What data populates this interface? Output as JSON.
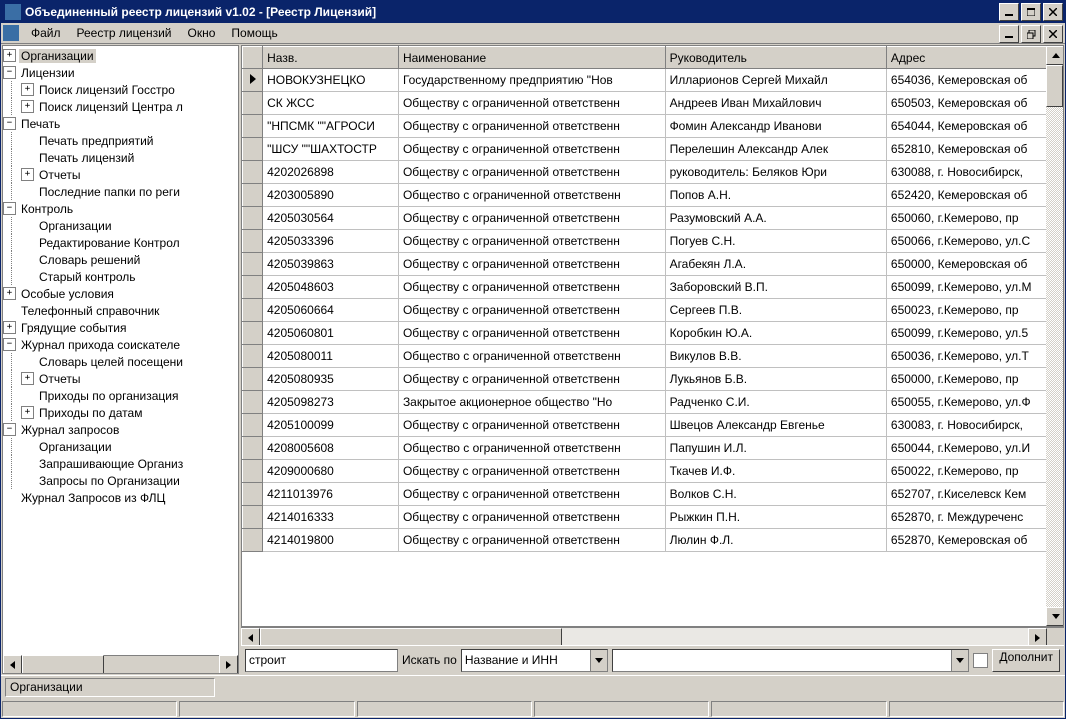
{
  "window": {
    "title": "Объединенный реестр лицензий v1.02 - [Реестр Лицензий]"
  },
  "menu": {
    "items": [
      "Файл",
      "Реестр лицензий",
      "Окно",
      "Помощь"
    ]
  },
  "tree": [
    {
      "level": 0,
      "pm": "+",
      "label": "Организации",
      "selected": true
    },
    {
      "level": 0,
      "pm": "-",
      "label": "Лицензии"
    },
    {
      "level": 1,
      "pm": "+",
      "label": "Поиск лицензий Госстро"
    },
    {
      "level": 1,
      "pm": "+",
      "label": "Поиск лицензий Центра л"
    },
    {
      "level": 0,
      "pm": "-",
      "label": "Печать"
    },
    {
      "level": 1,
      "pm": "",
      "label": "Печать предприятий"
    },
    {
      "level": 1,
      "pm": "",
      "label": "Печать лицензий"
    },
    {
      "level": 1,
      "pm": "+",
      "label": "Отчеты"
    },
    {
      "level": 1,
      "pm": "",
      "label": "Последние папки по реги"
    },
    {
      "level": 0,
      "pm": "-",
      "label": "Контроль"
    },
    {
      "level": 1,
      "pm": "",
      "label": "Организации"
    },
    {
      "level": 1,
      "pm": "",
      "label": "Редактирование Контрол"
    },
    {
      "level": 1,
      "pm": "",
      "label": "Словарь решений"
    },
    {
      "level": 1,
      "pm": "",
      "label": "Старый контроль"
    },
    {
      "level": 0,
      "pm": "+",
      "label": "Особые условия"
    },
    {
      "level": 0,
      "pm": "",
      "label": "Телефонный справочник"
    },
    {
      "level": 0,
      "pm": "+",
      "label": "Грядущие события"
    },
    {
      "level": 0,
      "pm": "-",
      "label": "Журнал прихода соискателе"
    },
    {
      "level": 1,
      "pm": "",
      "label": "Словарь целей посещени"
    },
    {
      "level": 1,
      "pm": "+",
      "label": "Отчеты"
    },
    {
      "level": 1,
      "pm": "",
      "label": "Приходы по организация"
    },
    {
      "level": 1,
      "pm": "+",
      "label": "Приходы по датам"
    },
    {
      "level": 0,
      "pm": "-",
      "label": "Журнал запросов"
    },
    {
      "level": 1,
      "pm": "",
      "label": "Организации"
    },
    {
      "level": 1,
      "pm": "",
      "label": "Запрашивающие Организ"
    },
    {
      "level": 1,
      "pm": "",
      "label": "Запросы по Организации"
    },
    {
      "level": 0,
      "pm": "",
      "label": "Журнал Запросов из ФЛЦ"
    }
  ],
  "grid": {
    "columns": [
      "Назв.",
      "Наименование",
      "Руководитель",
      "Адрес"
    ],
    "rows": [
      {
        "marker": "▶",
        "c": [
          " НОВОКУЗНЕЦКО",
          "Государственному предприятию \"Нов",
          "Илларионов Сергей Михайл",
          "654036, Кемеровская об"
        ]
      },
      {
        "marker": "",
        "c": [
          " СК ЖСС",
          "Обществу с ограниченной ответственн",
          "Андреев Иван Михайлович",
          "650503, Кемеровская об"
        ]
      },
      {
        "marker": "",
        "c": [
          "\"НПСМК \"\"АГРОСИ",
          "Обществу с ограниченной ответственн",
          "Фомин Александр Иванови",
          "654044, Кемеровская об"
        ]
      },
      {
        "marker": "",
        "c": [
          "\"ШСУ \"\"ШАХТОСТР",
          "Обществу с ограниченной ответственн",
          "Перелешин Александр Алек",
          "652810, Кемеровская об"
        ]
      },
      {
        "marker": "",
        "c": [
          "4202026898",
          "Обществу с ограниченной ответственн",
          "руководитель: Беляков Юри",
          "630088, г. Новосибирск,"
        ]
      },
      {
        "marker": "",
        "c": [
          "4203005890",
          "Общество с ограниченной ответственн",
          "Попов А.Н.",
          "652420, Кемеровская об"
        ]
      },
      {
        "marker": "",
        "c": [
          "4205030564",
          "Обществу с ограниченной ответственн",
          "Разумовский А.А.",
          " 650060, г.Кемерово, пр"
        ]
      },
      {
        "marker": "",
        "c": [
          "4205033396",
          "Обществу с ограниченной ответственн",
          "Погуев С.Н.",
          "650066, г.Кемерово, ул.С"
        ]
      },
      {
        "marker": "",
        "c": [
          "4205039863",
          "Обществу с ограниченной ответственн",
          "Агабекян Л.А.",
          "650000, Кемеровская об"
        ]
      },
      {
        "marker": "",
        "c": [
          "4205048603",
          "Обществу с ограниченной ответственн",
          "Заборовский В.П.",
          "650099, г.Кемерово, ул.М"
        ]
      },
      {
        "marker": "",
        "c": [
          "4205060664",
          "Обществу с ограниченной ответственн",
          "Сергеев П.В.",
          "650023, г.Кемерово, пр"
        ]
      },
      {
        "marker": "",
        "c": [
          "4205060801",
          "Обществу с ограниченной ответственн",
          "Коробкин Ю.А.",
          " 650099, г.Кемерово, ул.5"
        ]
      },
      {
        "marker": "",
        "c": [
          "4205080011",
          "Общество с ограниченной ответственн",
          "Викулов В.В.",
          "650036, г.Кемерово, ул.Т"
        ]
      },
      {
        "marker": "",
        "c": [
          "4205080935",
          "Обществу с ограниченной ответственн",
          "Лукьянов Б.В.",
          " 650000, г.Кемерово, пр"
        ]
      },
      {
        "marker": "",
        "c": [
          "4205098273",
          "Закрытое акционерное общество \"Но",
          "Радченко С.И.",
          "650055, г.Кемерово, ул.Ф"
        ]
      },
      {
        "marker": "",
        "c": [
          "4205100099",
          "Обществу с ограниченной ответственн",
          "Швецов Александр Евгенье",
          "630083, г. Новосибирск,"
        ]
      },
      {
        "marker": "",
        "c": [
          "4208005608",
          "Общество с ограниченной ответственн",
          "Папушин И.Л.",
          "650044, г.Кемерово, ул.И"
        ]
      },
      {
        "marker": "",
        "c": [
          "4209000680",
          "Обществу с ограниченной ответственн",
          "Ткачев И.Ф.",
          "650022, г.Кемерово, пр"
        ]
      },
      {
        "marker": "",
        "c": [
          "4211013976",
          "Обществу с ограниченной ответственн",
          "Волков С.Н.",
          "652707, г.Киселевск Кем"
        ]
      },
      {
        "marker": "",
        "c": [
          "4214016333",
          "Обществу с ограниченной ответственн",
          "Рыжкин П.Н.",
          "652870, г. Междуреченс"
        ]
      },
      {
        "marker": "",
        "c": [
          "4214019800",
          "Обществу с ограниченной ответственн",
          "Люлин Ф.Л.",
          "652870, Кемеровская об"
        ]
      }
    ]
  },
  "search": {
    "value": "строит",
    "label": "Искать по",
    "combo": "Название и ИНН",
    "button": "Дополнит"
  },
  "status": {
    "text": "Организации"
  }
}
